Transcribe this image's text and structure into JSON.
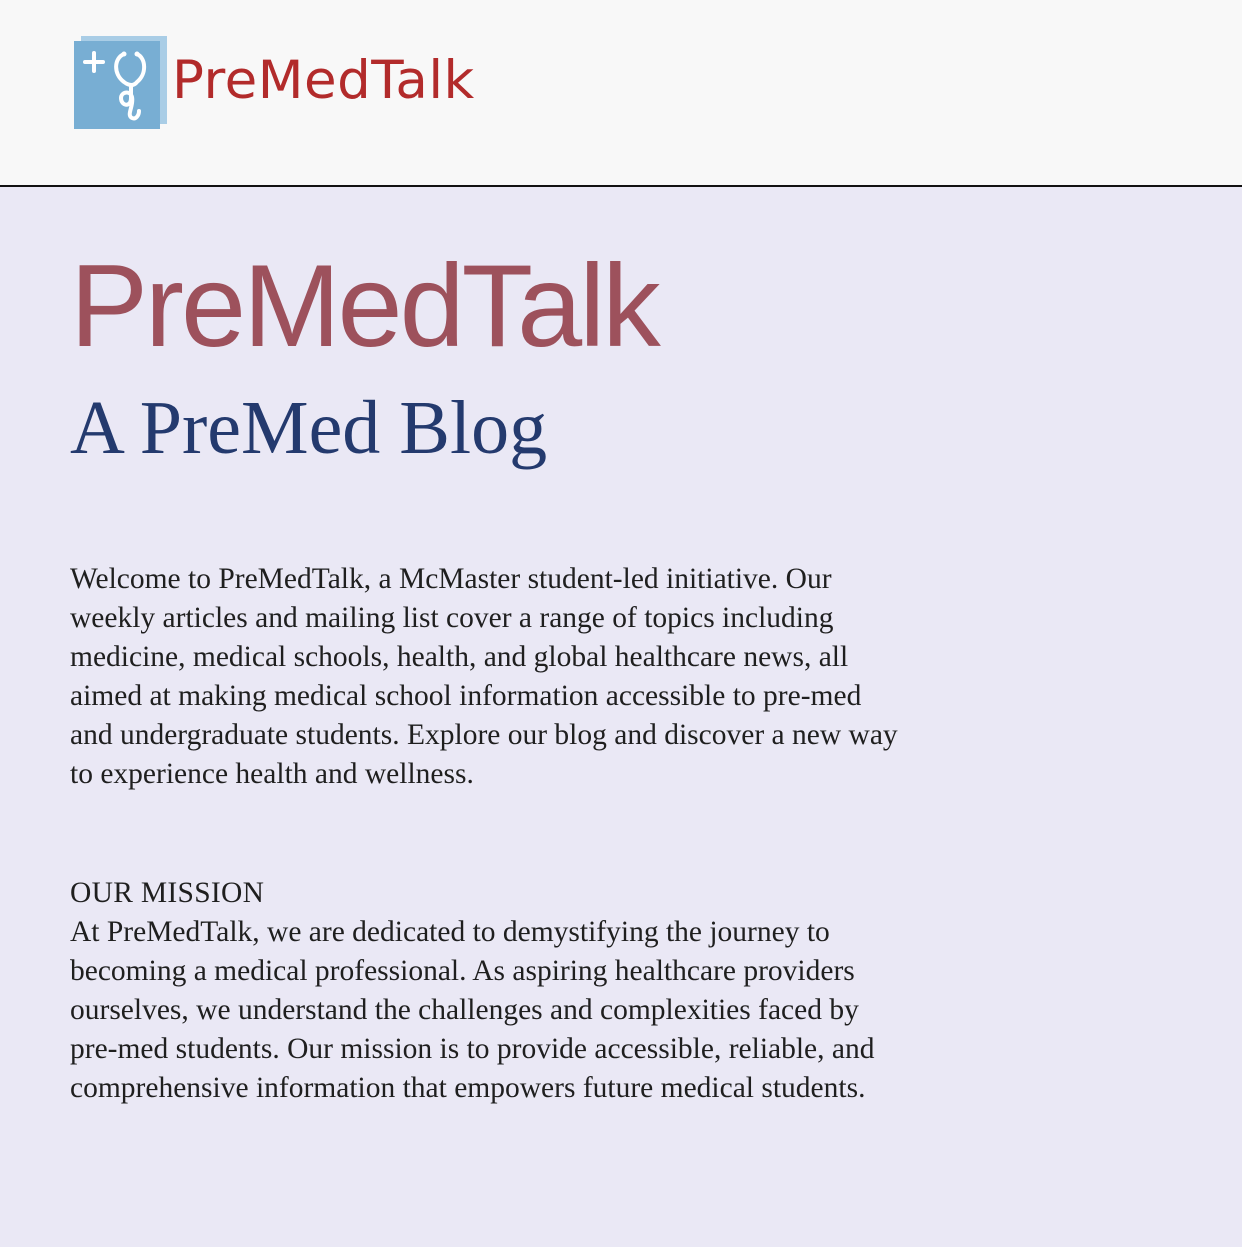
{
  "header": {
    "brand_name": "PreMedTalk",
    "logo_icon": "stethoscope-plus-icon",
    "colors": {
      "brand_text": "#b22b2b",
      "logo_tile": "#78aed3",
      "logo_tile_shadow": "#a9cde6",
      "header_bg": "#f8f8f8"
    }
  },
  "hero": {
    "title": "PreMedTalk",
    "subtitle": "A PreMed Blog",
    "colors": {
      "title": "#9d515c",
      "subtitle": "#243a6e",
      "page_bg": "#eae8f5"
    }
  },
  "intro": {
    "text": "Welcome to PreMedTalk, a McMaster student-led initiative. Our weekly articles and mailing list cover a range of topics including medicine, medical schools, health, and global healthcare news, all aimed at making medical school information accessible to pre-med and undergraduate students. Explore our blog and discover a new way to experience health and wellness."
  },
  "mission": {
    "heading": "OUR MISSION",
    "text": "At PreMedTalk, we are dedicated to demystifying the journey to becoming a medical professional. As aspiring healthcare providers ourselves, we understand the challenges and complexities faced by pre-med students. Our mission is to provide accessible, reliable, and comprehensive information that empowers future medical students."
  }
}
